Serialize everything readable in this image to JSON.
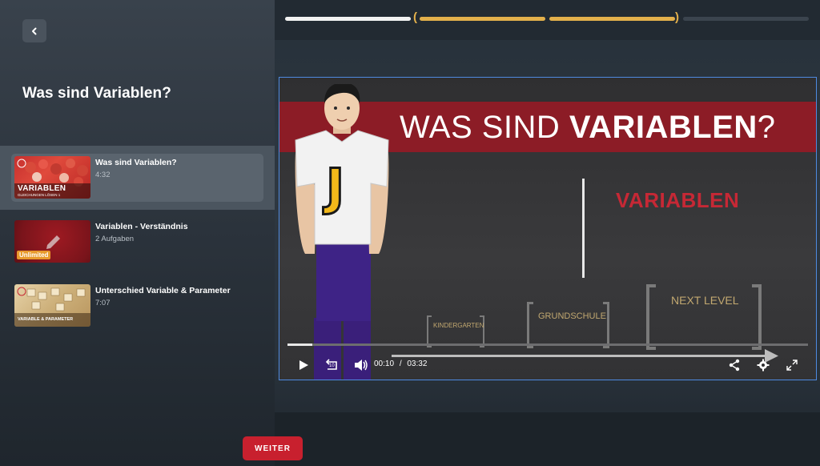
{
  "sidebar": {
    "back_icon": "chevron-left-icon",
    "title": "Was sind Variablen?",
    "lessons": [
      {
        "title": "Was sind Variablen?",
        "subtitle": "4:32",
        "thumb_title": "VARIABLEN",
        "thumb_sub": "GLEICHUNGEN LÖSEN 1",
        "active": true
      },
      {
        "title": "Variablen - Verständnis",
        "subtitle": "2 Aufgaben",
        "badge": "Unlimited",
        "active": false
      },
      {
        "title": "Unterschied Variable & Parameter",
        "subtitle": "7:07",
        "thumb_title": "VARIABLE & PARAMETER",
        "active": false
      }
    ]
  },
  "progress_bar": {
    "segments": 4,
    "completed": 1,
    "current_group": 2
  },
  "video": {
    "banner_prefix": "WAS SIND ",
    "banner_bold": "VARIABLEN",
    "banner_suffix": "?",
    "variables_label": "VARIABLEN",
    "stages": [
      "KINDERGARTEN",
      "GRUNDSCHULE",
      "NEXT LEVEL"
    ],
    "logo_letter": "J",
    "current_time": "00:10",
    "time_separator": "/",
    "duration": "03:32",
    "progress": 0.047
  },
  "controls": {
    "play_icon": "play-icon",
    "replay_icon": "replay-10-icon",
    "replay_label": "10",
    "volume_icon": "volume-icon",
    "share_icon": "share-icon",
    "settings_icon": "gear-icon",
    "fullscreen_icon": "fullscreen-icon"
  },
  "footer": {
    "next_label": "WEITER"
  },
  "colors": {
    "accent_red": "#c8202e",
    "progress_gold": "#e3b04b",
    "player_border": "#4e8ae0"
  }
}
